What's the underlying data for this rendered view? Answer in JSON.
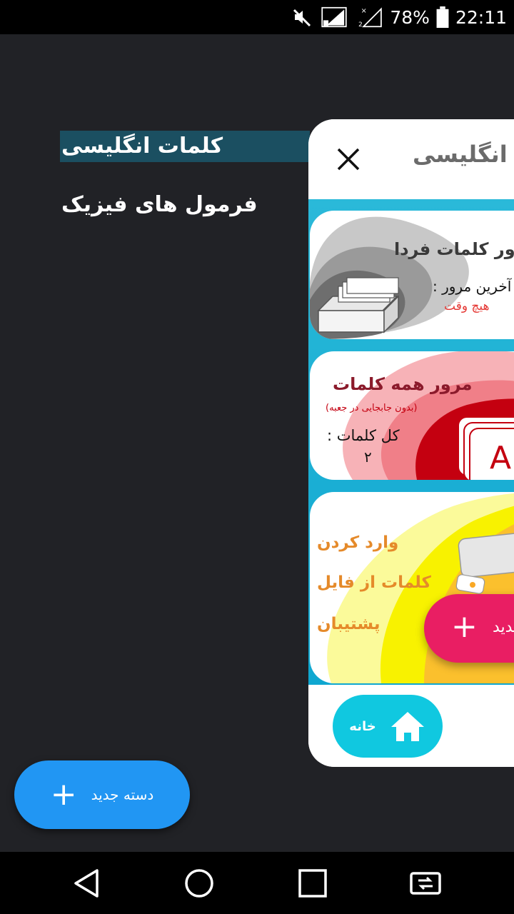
{
  "status_bar": {
    "battery": "78%",
    "time": "22:11",
    "icons": [
      "mute-icon",
      "sim1-signal-icon",
      "sim2-no-signal-icon",
      "battery-icon"
    ]
  },
  "drawer": {
    "categories": [
      {
        "label": "کلمات انگلیسی",
        "selected": true
      },
      {
        "label": "فرمول های فیزیک",
        "selected": false
      }
    ],
    "new_category_label": "دسته جدید"
  },
  "preview": {
    "title": "کلمات انگلیسی",
    "cards": {
      "review_tomorrow": {
        "title": "مرور کلمات فردا",
        "last_review_label": "آخرین مرور :",
        "last_review_value": "هیچ وقت"
      },
      "review_all": {
        "title": "مرور همه کلمات",
        "subtitle": "(بدون جابجایی در جعبه)",
        "total_label": "کل کلمات :",
        "total_value": "۲"
      },
      "import": {
        "line1": "وارد کردن",
        "line2": "کلمات از فایل",
        "line3": "پشتیبان"
      }
    },
    "fab_label": "کلمه جدید",
    "home_label": "خانه"
  },
  "colors": {
    "accent_blue": "#2196f3",
    "accent_pink": "#e91e63",
    "cyan": "#10c8e0",
    "drawer_highlight": "#1b4f61",
    "background": "#212226"
  }
}
